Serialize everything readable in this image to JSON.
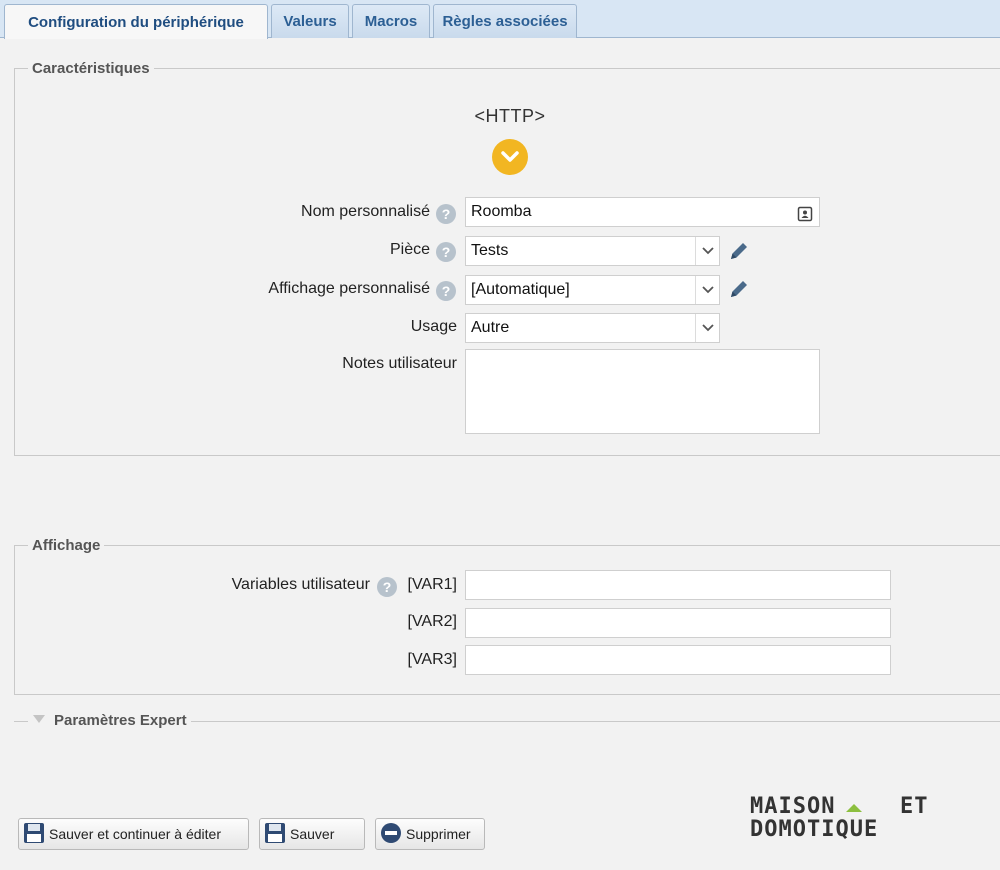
{
  "tabs": [
    {
      "label": "Configuration du périphérique"
    },
    {
      "label": "Valeurs"
    },
    {
      "label": "Macros"
    },
    {
      "label": "Règles associées"
    }
  ],
  "characteristics": {
    "legend": "Caractéristiques",
    "device_type": "<HTTP>",
    "custom_name_label": "Nom personnalisé",
    "custom_name_value": "Roomba",
    "room_label": "Pièce",
    "room_value": "Tests",
    "custom_display_label": "Affichage personnalisé",
    "custom_display_value": "[Automatique]",
    "usage_label": "Usage",
    "usage_value": "Autre",
    "notes_label": "Notes utilisateur",
    "notes_value": ""
  },
  "display": {
    "legend": "Affichage",
    "user_vars_label": "Variables utilisateur",
    "vars": [
      {
        "label": "[VAR1]",
        "value": ""
      },
      {
        "label": "[VAR2]",
        "value": ""
      },
      {
        "label": "[VAR3]",
        "value": ""
      }
    ]
  },
  "expert": {
    "legend": "Paramètres Expert"
  },
  "buttons": {
    "save_continue": "Sauver et continuer à éditer",
    "save": "Sauver",
    "delete": "Supprimer"
  },
  "logo": {
    "line1": "MAISON ET",
    "line2": "DOMOTIQUE"
  },
  "colors": {
    "accent": "#f2b622",
    "tab_text": "#2c5f94",
    "help": "#b7c2cc",
    "icon": "#4a6a8a"
  }
}
